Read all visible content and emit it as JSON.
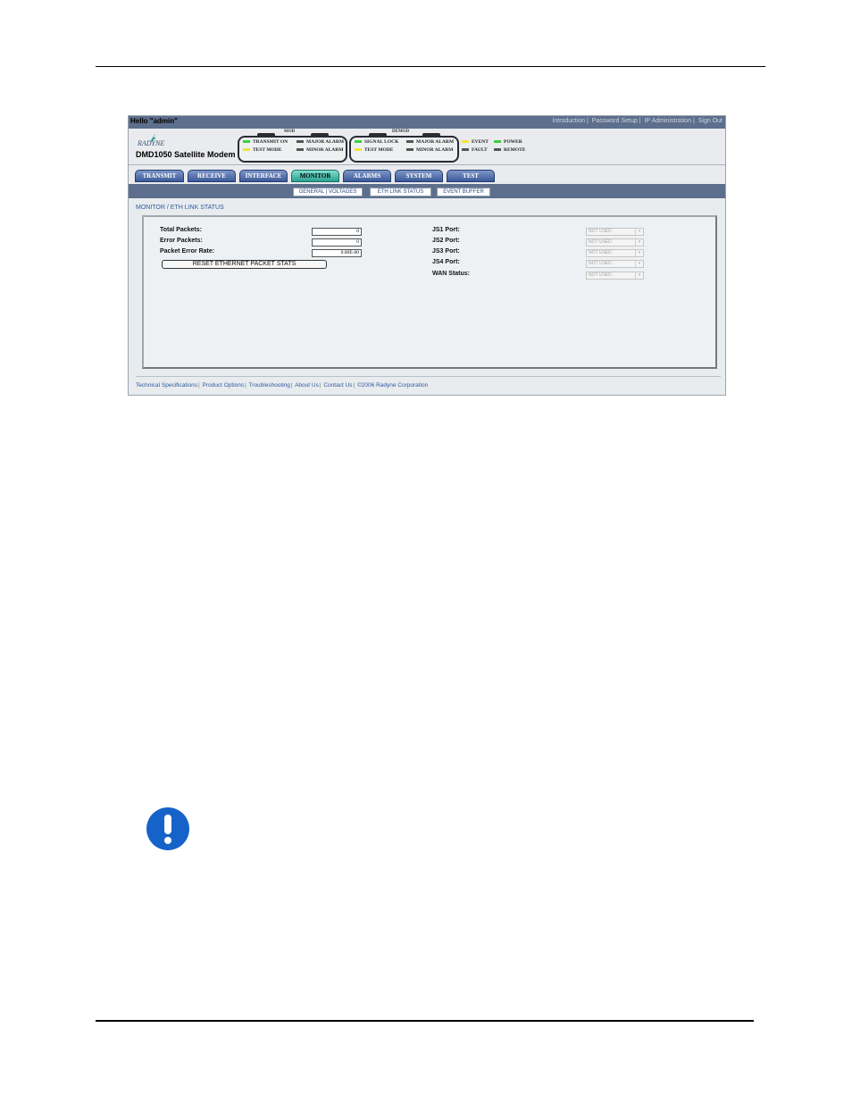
{
  "header": {
    "greeting": "Hello \"admin\"",
    "links": [
      "Introduction",
      "Password Setup",
      "IP Administration",
      "Sign Out"
    ],
    "logo_text": "RADYNE",
    "product": "DMD1050 Satellite Modem"
  },
  "status": {
    "mod_title": "MOD",
    "demod_title": "DEMOD",
    "mod": [
      {
        "label": "TRANSMIT ON",
        "color": "#3ad13a"
      },
      {
        "label": "MAJOR ALARM",
        "color": "#555555"
      },
      {
        "label": "TEST MODE",
        "color": "#f3e43a"
      },
      {
        "label": "MINOR ALARM",
        "color": "#555555"
      }
    ],
    "demod": [
      {
        "label": "SIGNAL LOCK",
        "color": "#3ad13a"
      },
      {
        "label": "MAJOR ALARM",
        "color": "#555555"
      },
      {
        "label": "TEST MODE",
        "color": "#f3e43a"
      },
      {
        "label": "MINOR ALARM",
        "color": "#555555"
      }
    ],
    "common": [
      {
        "label": "EVENT",
        "color": "#f3e43a"
      },
      {
        "label": "POWER",
        "color": "#3ad13a"
      },
      {
        "label": "FAULT",
        "color": "#555555"
      },
      {
        "label": "REMOTE",
        "color": "#555555"
      }
    ]
  },
  "tabs": [
    "TRANSMIT",
    "RECEIVE",
    "INTERFACE",
    "MONITOR",
    "ALARMS",
    "SYSTEM",
    "TEST"
  ],
  "active_tab": "MONITOR",
  "subtabs": [
    "GENERAL | VOLTAGES",
    "ETH LINK STATUS",
    "EVENT BUFFER"
  ],
  "breadcrumb": "MONITOR / ETH LINK STATUS",
  "eth": {
    "total_packets_label": "Total Packets:",
    "total_packets": "0",
    "error_packets_label": "Error Packets:",
    "error_packets": "0",
    "per_label": "Packet Error Rate:",
    "per": "0.00E-00",
    "reset_label": "RESET ETHERNET PACKET STATS"
  },
  "ports": [
    {
      "label": "JS1 Port:",
      "value": "NOT USED"
    },
    {
      "label": "JS2 Port:",
      "value": "NOT USED"
    },
    {
      "label": "JS3 Port:",
      "value": "NOT USED"
    },
    {
      "label": "JS4 Port:",
      "value": "NOT USED"
    },
    {
      "label": "WAN Status:",
      "value": "NOT USED"
    }
  ],
  "footer": [
    "Technical Specifications",
    "Product Options",
    "Troubleshooting",
    "About Us",
    "Contact Us",
    "©2006 Radyne Corporation"
  ],
  "notice_icon": "exclamation-icon"
}
